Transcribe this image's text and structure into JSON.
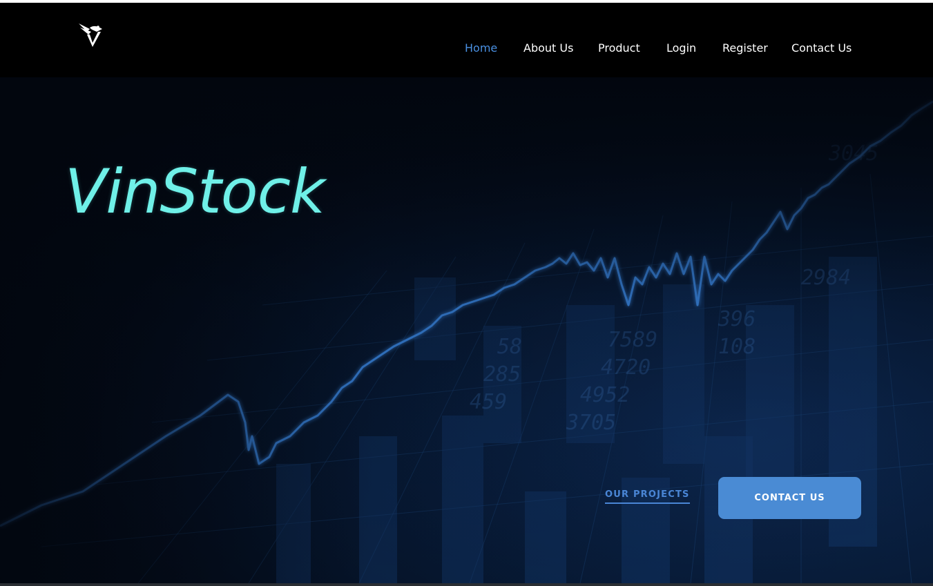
{
  "brand": {
    "logo_icon": "bird-v-logo-icon",
    "name": "VinStock"
  },
  "nav": {
    "items": [
      {
        "label": "Home",
        "active": true
      },
      {
        "label": "About Us",
        "active": false
      },
      {
        "label": "Product",
        "active": false
      },
      {
        "label": "Login",
        "active": false
      },
      {
        "label": "Register",
        "active": false
      },
      {
        "label": "Contact Us",
        "active": false
      }
    ]
  },
  "hero": {
    "title": "VinStock",
    "secondary_cta": "OUR PROJECTS",
    "primary_cta": "CONTACT US"
  },
  "colors": {
    "background": "#000000",
    "nav_active": "#4a90e2",
    "brand_title": "#6ff0e8",
    "cta_button": "#4a8bd4",
    "link": "#4a86d6"
  }
}
